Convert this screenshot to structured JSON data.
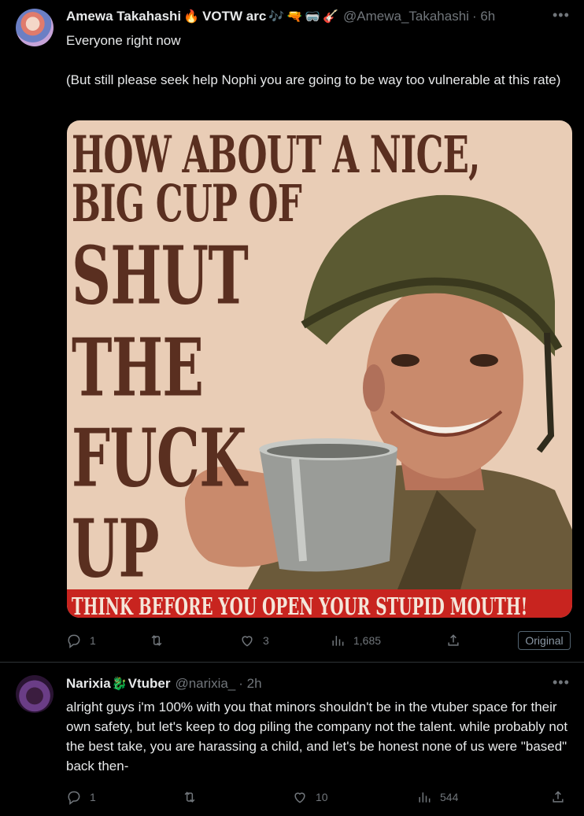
{
  "tweet1": {
    "author_name": "Amewa Takahashi",
    "author_badge": "VOTW arc",
    "emojis": [
      "🔥",
      "🎶",
      "🔫",
      "🥽",
      "🎸"
    ],
    "handle": "@Amewa_Takahashi",
    "time": "· 6h",
    "text_line1": "Everyone right now",
    "text_line2": "(But still please seek help Nophi you are going to be way too vulnerable at this rate)",
    "image": {
      "line1": "HOW ABOUT A NICE,",
      "line2": "BIG CUP OF",
      "line3": "SHUT",
      "line4": "THE",
      "line5": "FUCK",
      "line6": "UP",
      "banner": "THINK BEFORE YOU OPEN YOUR STUPID MOUTH!",
      "colors": {
        "bg": "#e9cdb6",
        "text": "#5a2f20",
        "banner": "#c8241f"
      }
    },
    "stats": {
      "replies": "1",
      "reposts": "",
      "likes": "3",
      "views": "1,685"
    },
    "original_label": "Original"
  },
  "tweet2": {
    "author_name": "Narixia",
    "emoji": "🐉",
    "author_badge": "Vtuber",
    "handle": "@narixia_",
    "time": "· 2h",
    "text": "alright guys i'm 100% with you that minors shouldn't be in the vtuber space for their own safety, but let's keep to dog piling the company not the talent. while probably not the best take, you are harassing a child, and let's be honest none of us were \"based\" back then-",
    "stats": {
      "replies": "1",
      "reposts": "",
      "likes": "10",
      "views": "544"
    }
  },
  "icons": [
    "reply-icon",
    "repost-icon",
    "like-icon",
    "views-icon",
    "share-icon",
    "more-icon"
  ]
}
